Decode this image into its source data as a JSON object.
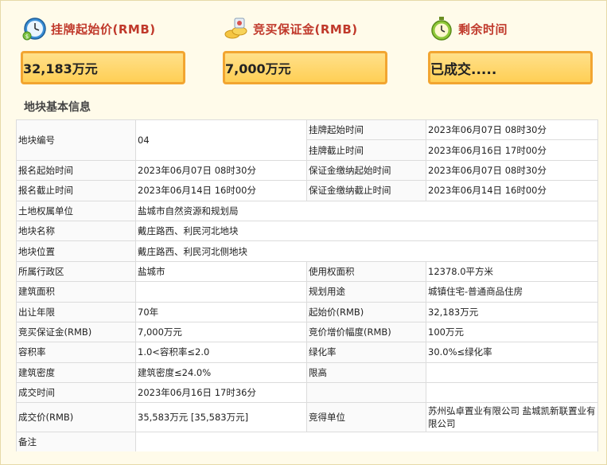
{
  "cards": {
    "start_price": {
      "title": "挂牌起始价(RMB)",
      "value": "32,183万元"
    },
    "deposit": {
      "title": "竞买保证金(RMB)",
      "value": "7,000万元"
    },
    "remaining": {
      "title": "剩余时间",
      "value": "已成交....."
    }
  },
  "section_title": "地块基本信息",
  "table": {
    "r1": {
      "l1": "地块编号",
      "v1": "04",
      "l2": "挂牌起始时间",
      "v2": "2023年06月07日 08时30分"
    },
    "r1b": {
      "l2": "挂牌截止时间",
      "v2": "2023年06月16日 17时00分"
    },
    "r2": {
      "l1": "报名起始时间",
      "v1": "2023年06月07日 08时30分",
      "l2": "保证金缴纳起始时间",
      "v2": "2023年06月07日 08时30分"
    },
    "r3": {
      "l1": "报名截止时间",
      "v1": "2023年06月14日 16时00分",
      "l2": "保证金缴纳截止时间",
      "v2": "2023年06月14日 16时00分"
    },
    "r4": {
      "l1": "土地权属单位",
      "v1": "盐城市自然资源和规划局"
    },
    "r5": {
      "l1": "地块名称",
      "v1": "戴庄路西、利民河北地块"
    },
    "r6": {
      "l1": "地块位置",
      "v1": "戴庄路西、利民河北侧地块"
    },
    "r7": {
      "l1": "所属行政区",
      "v1": "盐城市",
      "l2": "使用权面积",
      "v2": "12378.0平方米"
    },
    "r8": {
      "l1": "建筑面积",
      "v1": "",
      "l2": "规划用途",
      "v2": "城镇住宅-普通商品住房"
    },
    "r9": {
      "l1": "出让年限",
      "v1": "70年",
      "l2": "起始价(RMB)",
      "v2": "32,183万元"
    },
    "r10": {
      "l1": "竞买保证金(RMB)",
      "v1": "7,000万元",
      "l2": "竞价增价幅度(RMB)",
      "v2": "100万元"
    },
    "r11": {
      "l1": "容积率",
      "v1": "1.0<容积率≤2.0",
      "l2": "绿化率",
      "v2": "30.0%≤绿化率"
    },
    "r12": {
      "l1": "建筑密度",
      "v1": "建筑密度≤24.0%",
      "l2": "限高",
      "v2": ""
    },
    "r13": {
      "l1": "成交时间",
      "v1": "2023年06月16日 17时36分",
      "l2": "",
      "v2": ""
    },
    "r14": {
      "l1": "成交价(RMB)",
      "v1": "35,583万元 [35,583万元]",
      "l2": "竞得单位",
      "v2": "苏州弘卓置业有限公司 盐城凯新联置业有限公司"
    },
    "r15": {
      "l1": "备注",
      "v1": ""
    }
  },
  "colors": {
    "accent_red": "#c0392b",
    "box_border": "#f2a531",
    "box_fill": "#ffd76a"
  },
  "icons": [
    "alarm-clock-icon",
    "coins-icon",
    "timer-icon"
  ]
}
